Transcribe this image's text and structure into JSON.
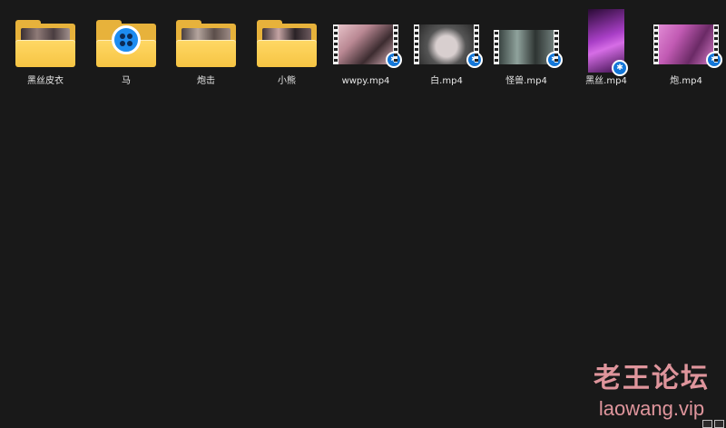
{
  "items": [
    {
      "kind": "folder",
      "name": "黑丝皮衣",
      "photo": "#5a4a4a"
    },
    {
      "kind": "folder-app",
      "name": "马"
    },
    {
      "kind": "folder",
      "name": "炮击",
      "photo": "#7a6a64"
    },
    {
      "kind": "folder",
      "name": "小熊",
      "photo": "#6d5a5e"
    },
    {
      "kind": "video",
      "name": "wwpy.mp4",
      "frame": "#c99aa5"
    },
    {
      "kind": "video",
      "name": "白.mp4",
      "frame": "#8a8a8a"
    },
    {
      "kind": "video",
      "name": "怪兽.mp4",
      "frame": "#6f7d7a"
    },
    {
      "kind": "video-tall",
      "name": "黑丝.mp4",
      "frame": "#a93fc7"
    },
    {
      "kind": "video",
      "name": "炮.mp4",
      "frame": "#c15ab3"
    }
  ],
  "watermark": {
    "title": "老王论坛",
    "url": "laowang.vip"
  },
  "colors": {
    "background": "#191919",
    "folder": "#f6c443",
    "badge": "#1477d8"
  }
}
